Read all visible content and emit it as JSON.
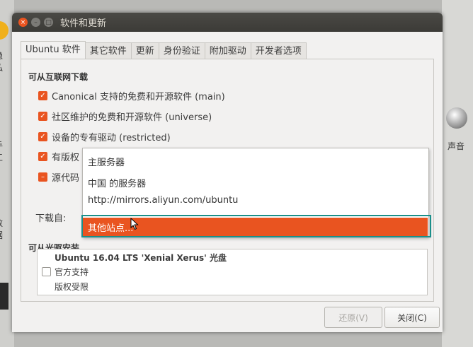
{
  "background": {
    "left_fragments": [
      "隐私",
      "手工",
      "数据"
    ],
    "right_label": "声音"
  },
  "window": {
    "title": "软件和更新",
    "tabs": [
      {
        "label": "Ubuntu 软件"
      },
      {
        "label": "其它软件"
      },
      {
        "label": "更新"
      },
      {
        "label": "身份验证"
      },
      {
        "label": "附加驱动"
      },
      {
        "label": "开发者选项"
      }
    ],
    "internet_section_title": "可从互联网下载",
    "sources": [
      {
        "label": "Canonical 支持的免费和开源软件 (main)",
        "checked": true
      },
      {
        "label": "社区维护的免费和开源软件 (universe)",
        "checked": true
      },
      {
        "label": "设备的专有驱动 (restricted)",
        "checked": true
      },
      {
        "label": "有版权",
        "checked": true
      },
      {
        "label": "源代码",
        "checked": "partial"
      }
    ],
    "download_from_label": "下载自:",
    "cdrom_section_title": "可从光驱安装",
    "cdrom": {
      "title": "Ubuntu 16.04 LTS 'Xenial Xerus' 光盘",
      "lines": [
        "官方支持",
        "版权受限"
      ],
      "checked": false
    },
    "buttons": {
      "revert": "还原(V)",
      "close": "关闭(C)"
    }
  },
  "dropdown": {
    "items": [
      "主服务器",
      "中国 的服务器",
      "http://mirrors.aliyun.com/ubuntu"
    ],
    "selected": "其他站点..."
  },
  "colors": {
    "accent": "#e95420",
    "titlebar": "#3c3b37",
    "highlight": "#1a8f8a"
  }
}
